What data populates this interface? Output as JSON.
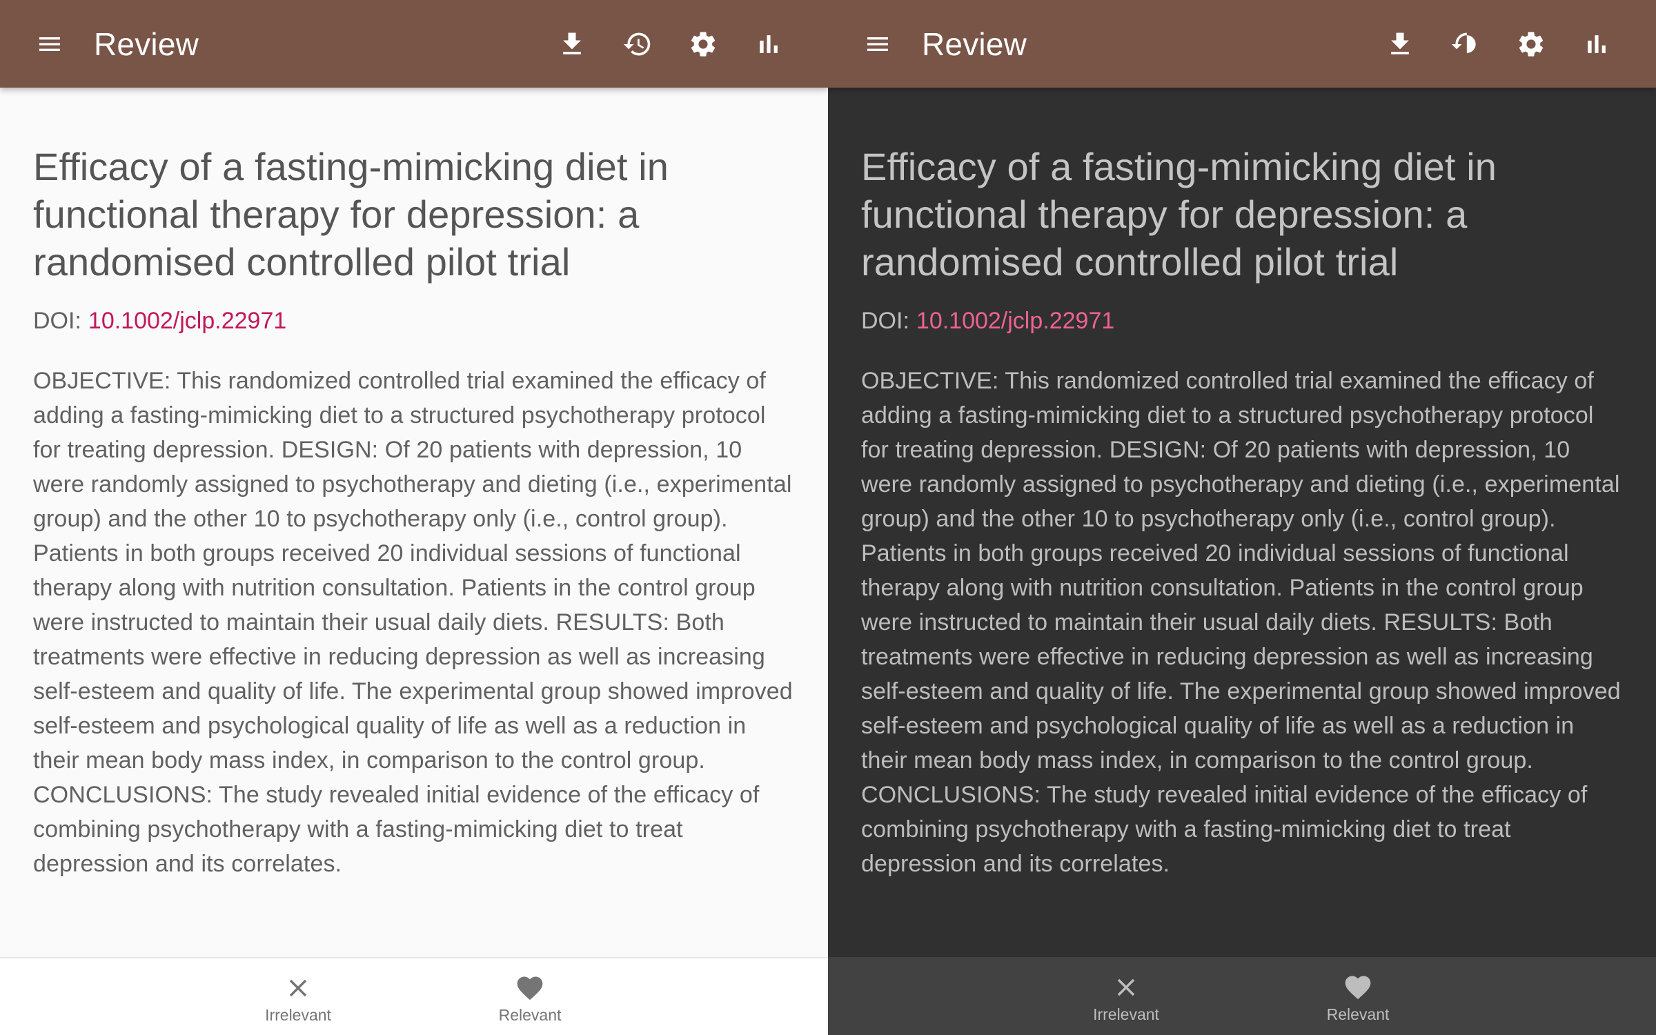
{
  "colors": {
    "appbar": "#795548",
    "doi_link_light": "#c2185b",
    "doi_link_dark": "#f06292",
    "light_background": "#fafafa",
    "dark_background": "#303030"
  },
  "screens": [
    {
      "theme": "light",
      "appbar": {
        "title": "Review",
        "icons": [
          "menu-icon",
          "download-icon",
          "history-icon",
          "settings-icon",
          "bar-chart-icon"
        ]
      },
      "article": {
        "title": "Efficacy of a fasting-mimicking diet in functional therapy for depression: a randomised controlled pilot trial",
        "doi_label": "DOI:",
        "doi_value": "10.1002/jclp.22971",
        "abstract": "OBJECTIVE: This randomized controlled trial examined the efficacy of adding a fasting-mimicking diet to a structured psychotherapy protocol for treating depression. DESIGN: Of 20 patients with depression, 10 were randomly assigned to psychotherapy and dieting (i.e., experimental group) and the other 10 to psychotherapy only (i.e., control group). Patients in both groups received 20 individual sessions of functional therapy along with nutrition consultation. Patients in the control group were instructed to maintain their usual daily diets. RESULTS: Both treatments were effective in reducing depression as well as increasing self-esteem and quality of life. The experimental group showed improved self-esteem and psychological quality of life as well as a reduction in their mean body mass index, in comparison to the control group. CONCLUSIONS: The study revealed initial evidence of the efficacy of combining psychotherapy with a fasting-mimicking diet to treat depression and its correlates."
      },
      "bottom_nav": {
        "irrelevant_label": "Irrelevant",
        "relevant_label": "Relevant"
      }
    },
    {
      "theme": "dark",
      "appbar": {
        "title": "Review",
        "icons": [
          "menu-icon",
          "download-icon",
          "history-icon",
          "settings-icon",
          "bar-chart-icon"
        ]
      },
      "article": {
        "title": "Efficacy of a fasting-mimicking diet in functional therapy for depression: a randomised controlled pilot trial",
        "doi_label": "DOI:",
        "doi_value": "10.1002/jclp.22971",
        "abstract": "OBJECTIVE: This randomized controlled trial examined the efficacy of adding a fasting-mimicking diet to a structured psychotherapy protocol for treating depression. DESIGN: Of 20 patients with depression, 10 were randomly assigned to psychotherapy and dieting (i.e., experimental group) and the other 10 to psychotherapy only (i.e., control group). Patients in both groups received 20 individual sessions of functional therapy along with nutrition consultation. Patients in the control group were instructed to maintain their usual daily diets. RESULTS: Both treatments were effective in reducing depression as well as increasing self-esteem and quality of life. The experimental group showed improved self-esteem and psychological quality of life as well as a reduction in their mean body mass index, in comparison to the control group. CONCLUSIONS: The study revealed initial evidence of the efficacy of combining psychotherapy with a fasting-mimicking diet to treat depression and its correlates."
      },
      "bottom_nav": {
        "irrelevant_label": "Irrelevant",
        "relevant_label": "Relevant"
      }
    }
  ]
}
